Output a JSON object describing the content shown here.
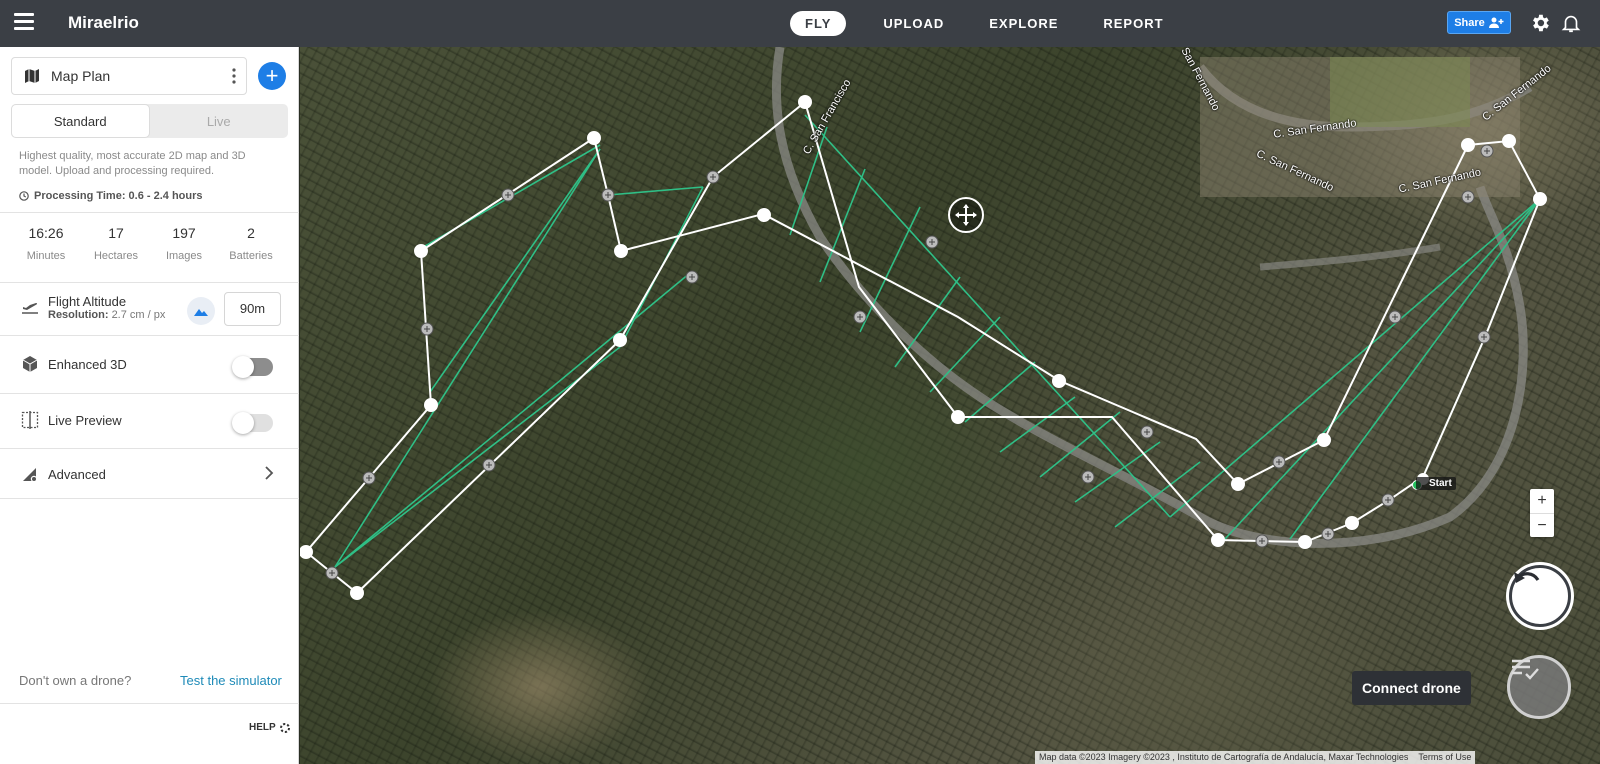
{
  "app": {
    "brand": "Miraelrio"
  },
  "nav": {
    "tabs": [
      {
        "label": "FLY"
      },
      {
        "label": "UPLOAD"
      },
      {
        "label": "EXPLORE"
      },
      {
        "label": "REPORT"
      }
    ]
  },
  "header": {
    "share_label": "Share"
  },
  "sidebar": {
    "plan_name": "Map Plan",
    "mode": {
      "standard": "Standard",
      "live": "Live"
    },
    "description": "Highest quality, most accurate 2D map and 3D model. Upload and processing required.",
    "processing_time": "Processing Time: 0.6 - 2.4 hours",
    "stats": [
      {
        "value": "16:26",
        "label": "Minutes"
      },
      {
        "value": "17",
        "label": "Hectares"
      },
      {
        "value": "197",
        "label": "Images"
      },
      {
        "value": "2",
        "label": "Batteries"
      }
    ],
    "flight_altitude": {
      "title": "Flight Altitude",
      "res_label": "Resolution:",
      "res_value": "2.7 cm / px",
      "value": "90m"
    },
    "enhanced_3d": "Enhanced 3D",
    "live_preview": "Live Preview",
    "advanced": "Advanced",
    "no_drone_text": "Don't own a drone?",
    "simulator_link": "Test the simulator",
    "help": "HELP"
  },
  "map": {
    "streets": [
      "C. San Francisco",
      "C. San Fernando",
      "C. San Fernando",
      "C. San Fernando",
      "C. San Fernando",
      "C. San Fernando"
    ],
    "start_label": "Start",
    "zoom_in": "+",
    "zoom_out": "−",
    "connect_label": "Connect drone",
    "attribution": "Map data ©2023 Imagery ©2023 , Instituto de Cartografía de Andalucía, Maxar Technologies",
    "terms": "Terms of Use"
  },
  "colors": {
    "accent": "#1e7ee6",
    "topbar": "#3b3f45",
    "flight_line": "#2fbf86",
    "link": "#1f8bb8"
  }
}
